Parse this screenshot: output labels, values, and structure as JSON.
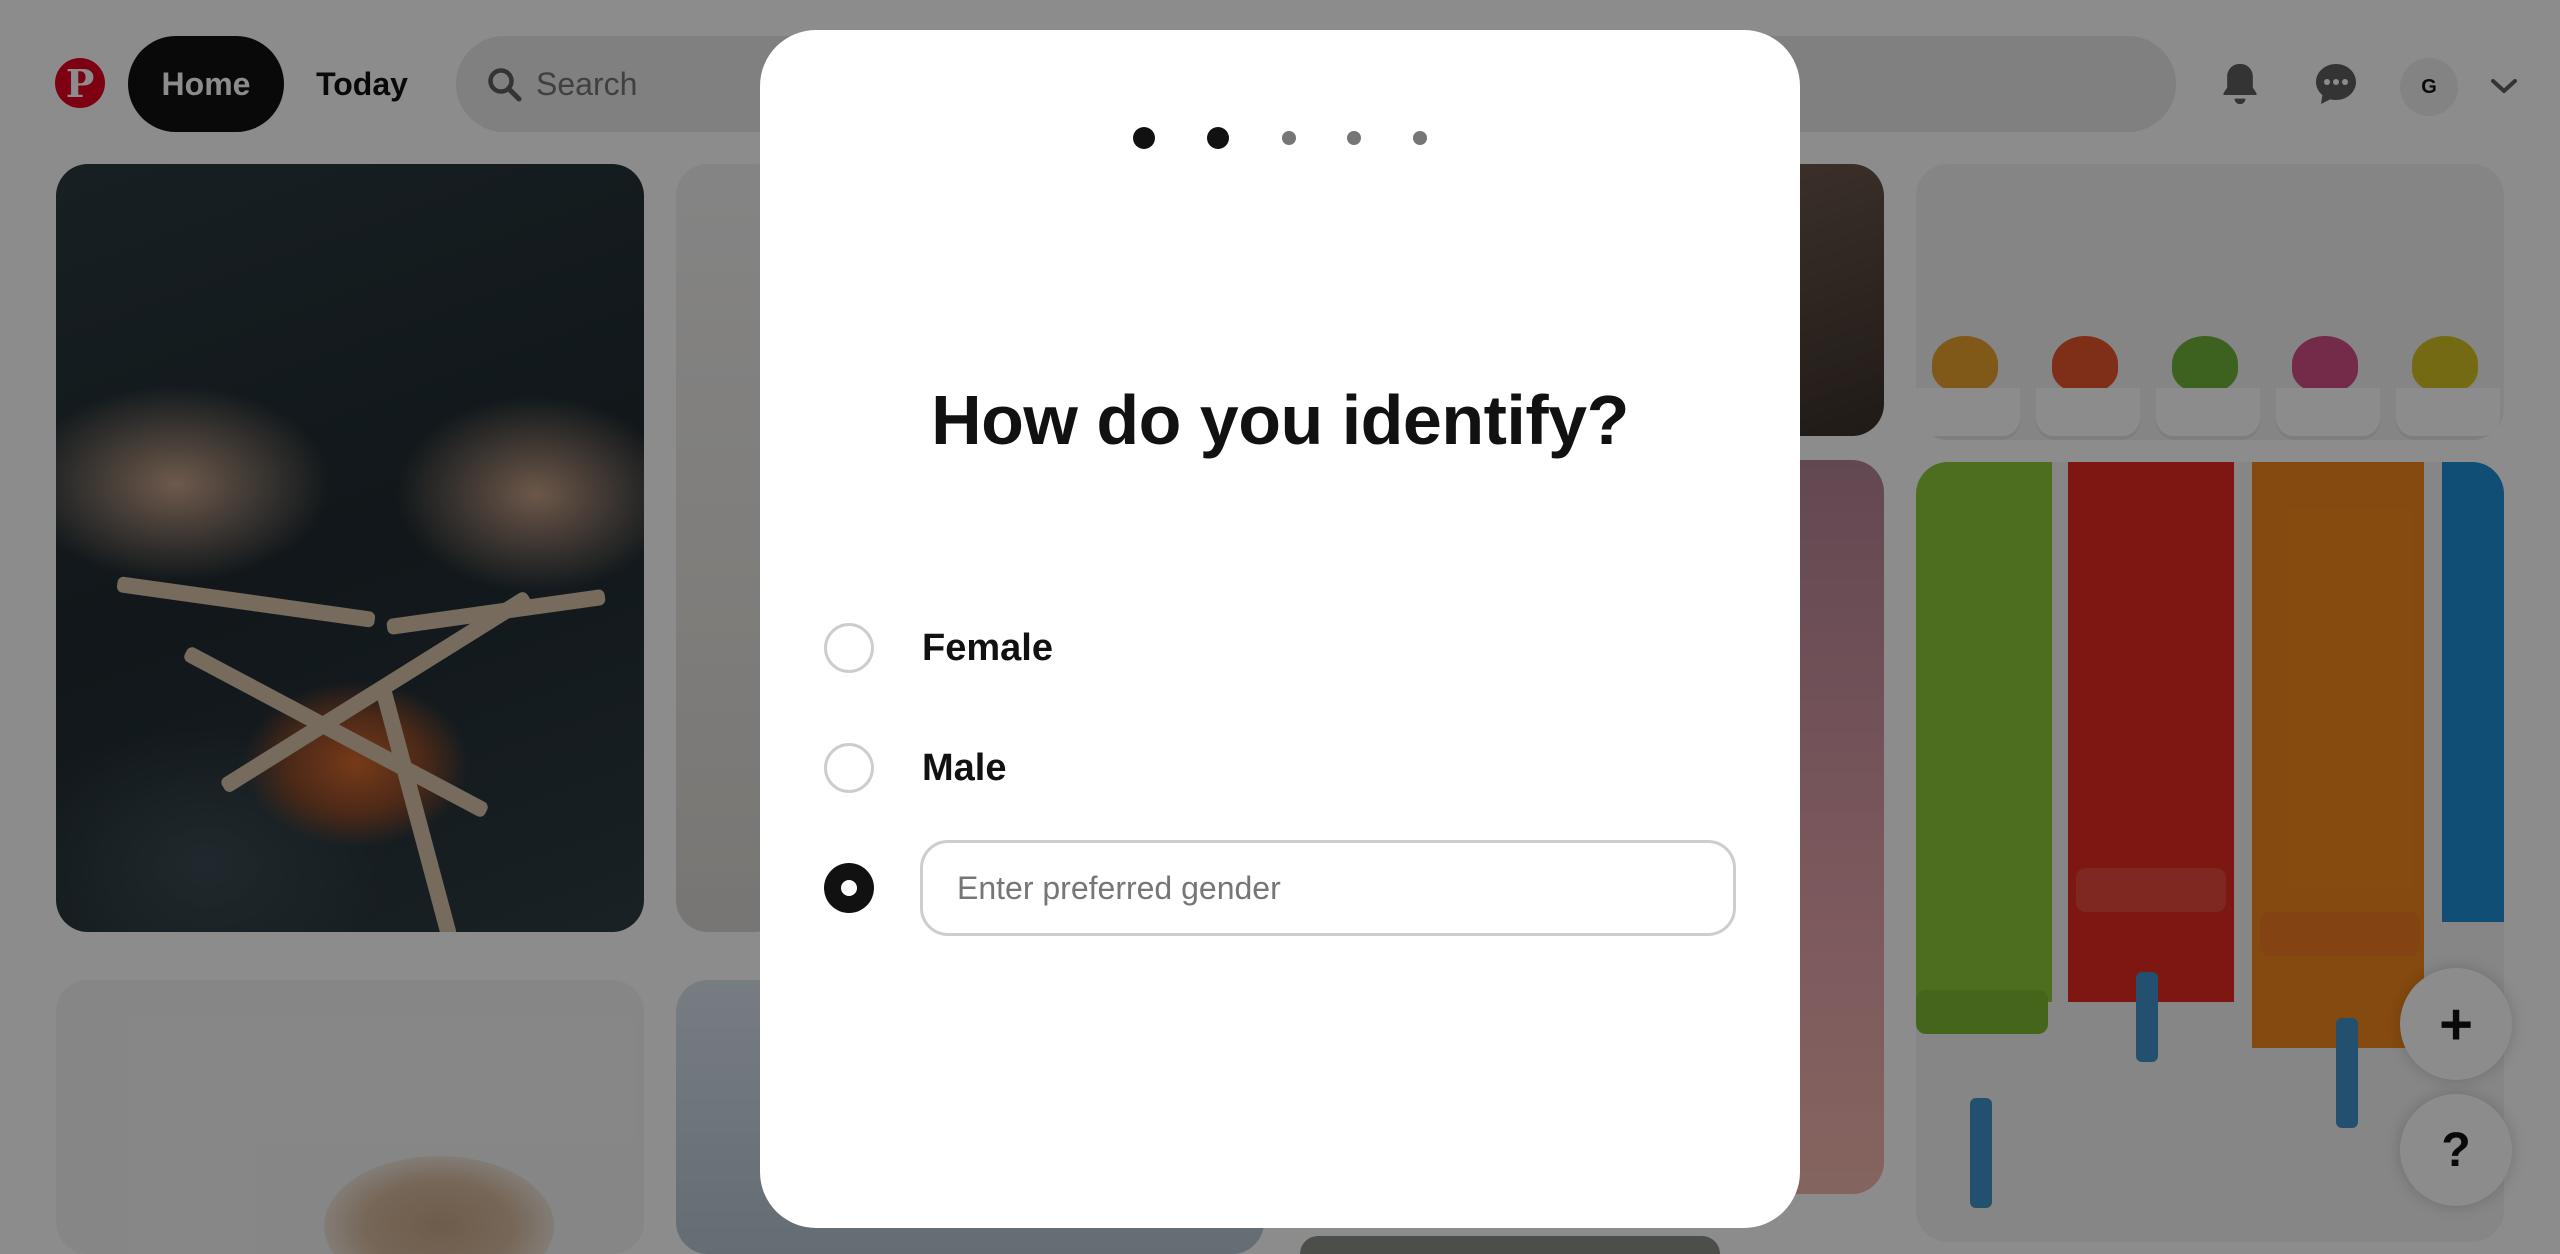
{
  "header": {
    "logo_glyph": "P",
    "nav": {
      "home": "Home",
      "today": "Today"
    },
    "search": {
      "placeholder": "Search"
    },
    "avatar_initial": "G",
    "icons": [
      "pinterest-logo-icon",
      "search-icon",
      "bell-icon",
      "chat-bubble-icon",
      "chevron-down-icon"
    ]
  },
  "fabs": {
    "add": "+",
    "help": "?"
  },
  "modal": {
    "steps": {
      "total": 5,
      "completed": 2
    },
    "title": "How do you identify?",
    "options": [
      {
        "label": "Female",
        "selected": false
      },
      {
        "label": "Male",
        "selected": false
      },
      {
        "label": "",
        "selected": true
      }
    ],
    "custom_input": {
      "placeholder": "Enter preferred gender",
      "value": ""
    }
  },
  "colors": {
    "brand": "#e60023",
    "primary_text": "#111111",
    "muted_text": "#767676",
    "overlay": "rgba(0,0,0,0.45)",
    "input_border": "#cdcdcd"
  }
}
